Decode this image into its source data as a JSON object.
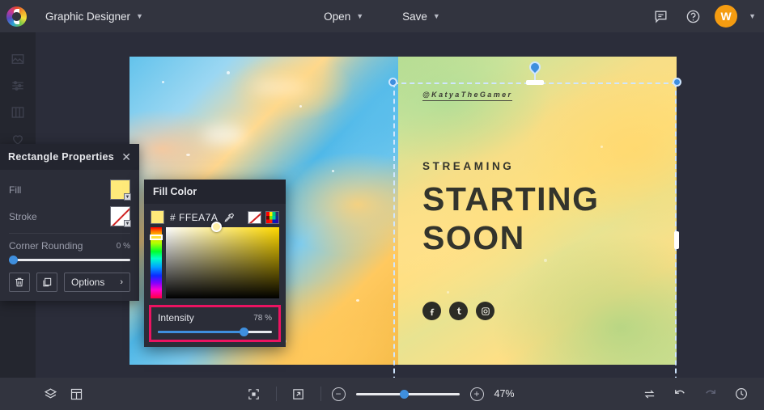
{
  "topbar": {
    "logo_icon": "color-wheel-logo-icon",
    "document_title": "Graphic Designer",
    "title_chevron_icon": "chevron-down-icon",
    "open_label": "Open",
    "save_label": "Save",
    "open_chevron_icon": "chevron-down-icon",
    "save_chevron_icon": "chevron-down-icon",
    "feedback_icon": "chat-bubble-icon",
    "help_icon": "question-circle-icon",
    "avatar_initial": "W",
    "avatar_color": "#F59C11",
    "avatar_chevron_icon": "chevron-down-icon"
  },
  "left_rail": {
    "items": [
      {
        "name": "image-icon"
      },
      {
        "name": "adjust-sliders-icon"
      },
      {
        "name": "columns-icon"
      },
      {
        "name": "heart-icon"
      }
    ]
  },
  "properties_panel": {
    "title": "Rectangle Properties",
    "close_icon": "close-icon",
    "fill_label": "Fill",
    "fill_color": "#FFEA7A",
    "stroke_label": "Stroke",
    "stroke_color": "none",
    "corner_rounding_label": "Corner Rounding",
    "corner_rounding_value": "0 %",
    "corner_rounding_percent": 0,
    "delete_icon": "trash-icon",
    "duplicate_icon": "copy-icon",
    "options_label": "Options",
    "options_chevron_icon": "chevron-right-icon"
  },
  "fill_color_popup": {
    "title": "Fill Color",
    "hex_value": "# FFEA7A",
    "swatch_color": "#FFEA7A",
    "eyedropper_icon": "eyedropper-icon",
    "no_color_icon": "no-color-icon",
    "palette_icon": "color-palette-icon",
    "intensity_label": "Intensity",
    "intensity_value": "78 %",
    "intensity_percent": 78,
    "highlight_color": "#EC1361"
  },
  "canvas": {
    "handle_text": "@KatyaTheGamer",
    "streaming_text": "STREAMING",
    "headline_line1": "STARTING",
    "headline_line2": "SOON",
    "socials": [
      {
        "name": "facebook-icon",
        "glyph": "f"
      },
      {
        "name": "tumblr-icon",
        "glyph": "t"
      },
      {
        "name": "instagram-icon",
        "glyph": "▣"
      }
    ]
  },
  "bottombar": {
    "layers_icon": "layers-icon",
    "layout_icon": "layout-panels-icon",
    "fit_screen_icon": "fit-to-screen-icon",
    "fullscreen_icon": "expand-arrow-icon",
    "zoom_out_label": "−",
    "zoom_in_label": "+",
    "zoom_value": "47%",
    "zoom_percent": 47,
    "swap_icon": "swap-arrows-icon",
    "undo_icon": "undo-arrow-icon",
    "redo_icon": "redo-arrow-icon",
    "history_icon": "history-clock-icon"
  }
}
